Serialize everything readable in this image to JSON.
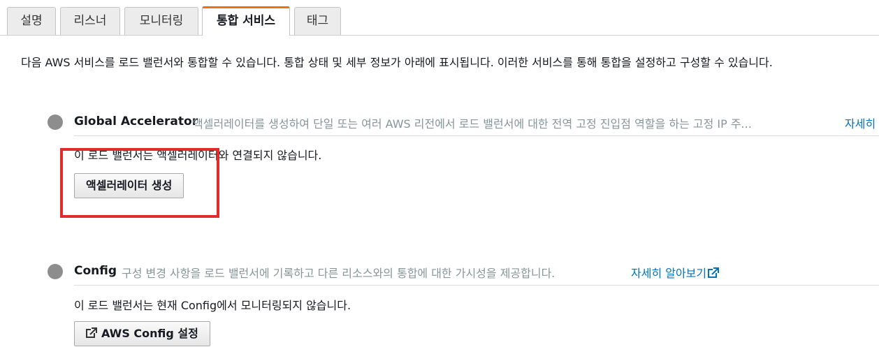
{
  "tabs": [
    {
      "label": "설명",
      "active": false
    },
    {
      "label": "리스너",
      "active": false
    },
    {
      "label": "모니터링",
      "active": false
    },
    {
      "label": "통합 서비스",
      "active": true
    },
    {
      "label": "태그",
      "active": false
    }
  ],
  "intro": "다음 AWS 서비스를 로드 밸런서와 통합할 수 있습니다. 통합 상태 및 세부 정보가 아래에 표시됩니다. 이러한 서비스를 통해 통합을 설정하고 구성할 수 있습니다.",
  "global_accelerator": {
    "title": "Global Accelerator",
    "description": "액셀러레이터를 생성하여 단일 또는 여러 AWS 리전에서 로드 밸런서에 대한 전역 고정 진입점 역할을 하는 고정 IP 주...",
    "learn_more": "자세히",
    "status": "이 로드 밸런서는 액셀러레이터와 연결되지 않습니다.",
    "button": "액셀러레이터 생성"
  },
  "config": {
    "title": "Config",
    "description": "구성 변경 사항을 로드 밸런서에 기록하고 다른 리소스와의 통합에 대한 가시성을 제공합니다.",
    "learn_more": "자세히 알아보기",
    "status": "이 로드 밸런서는 현재 Config에서 모니터링되지 않습니다.",
    "button": "AWS Config 설정"
  },
  "colors": {
    "active_tab_accent": "#ec7211",
    "link": "#0073bb",
    "highlight": "#dd2d2d"
  },
  "icons": {
    "bullet": "status-circle-icon",
    "external_link": "external-link-icon"
  }
}
